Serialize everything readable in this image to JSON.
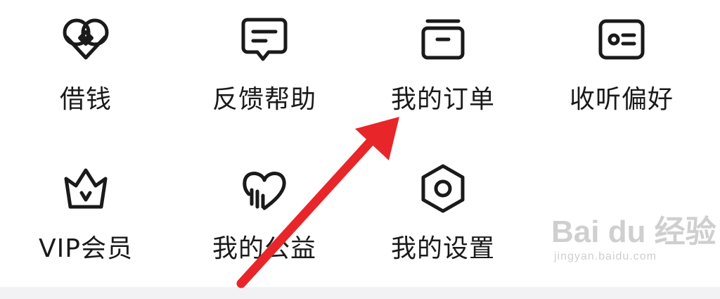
{
  "menu": {
    "items": [
      {
        "label": "借钱",
        "icon": "coins-icon"
      },
      {
        "label": "反馈帮助",
        "icon": "feedback-chat-icon"
      },
      {
        "label": "我的订单",
        "icon": "orders-box-icon"
      },
      {
        "label": "收听偏好",
        "icon": "preference-card-icon"
      },
      {
        "label": "VIP会员",
        "icon": "crown-icon"
      },
      {
        "label": "我的公益",
        "icon": "charity-heart-icon"
      },
      {
        "label": "我的设置",
        "icon": "settings-hexagon-icon"
      }
    ]
  },
  "annotation": {
    "arrow_color": "#e8262a",
    "icon_color": "#1a1a1a"
  },
  "watermark": {
    "brand": "Bai du 经验",
    "url": "jingyan.baidu.com"
  }
}
